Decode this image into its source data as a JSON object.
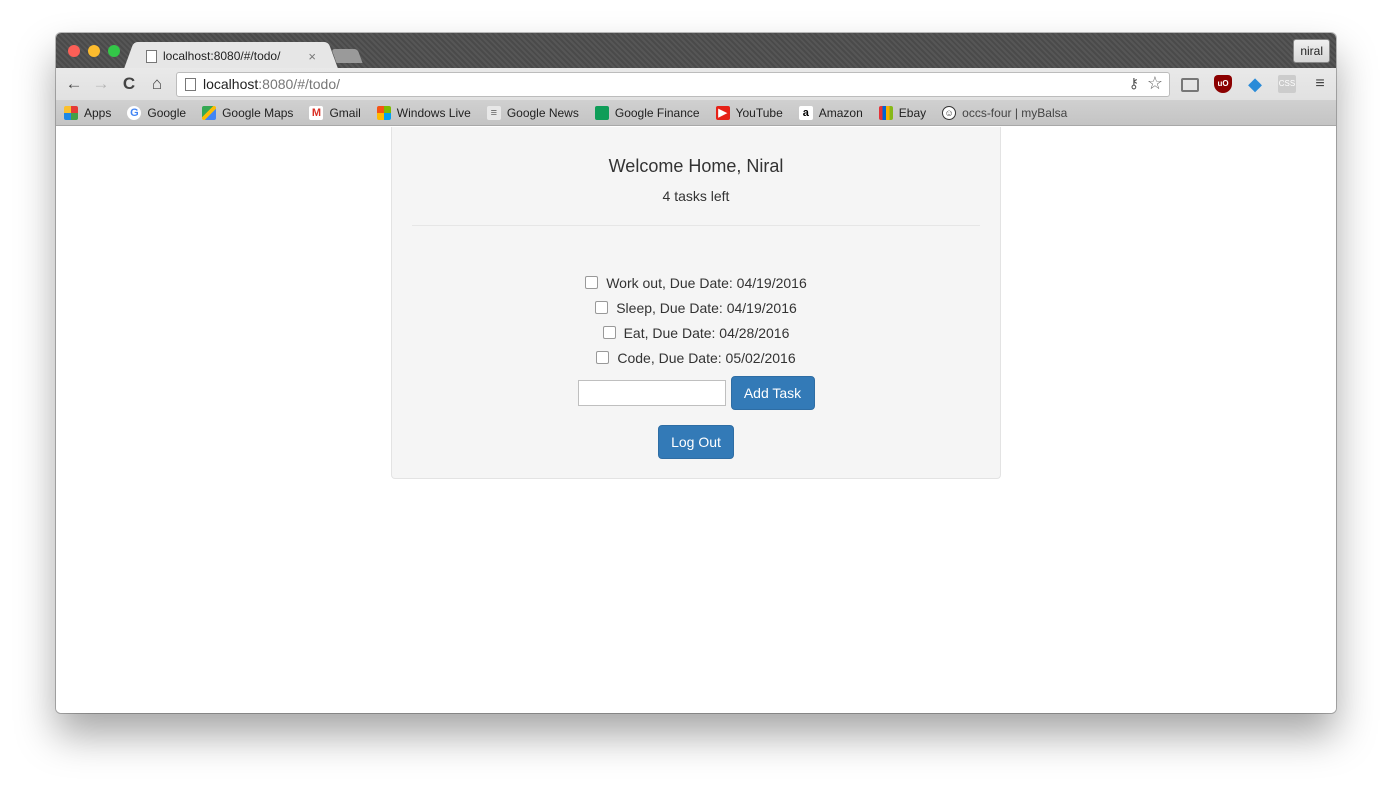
{
  "browser": {
    "tab_title": "localhost:8080/#/todo/",
    "tab_close": "×",
    "profile_name": "niral",
    "url_host": "localhost",
    "url_rest": ":8080/#/todo/",
    "nav": {
      "back": "←",
      "forward": "→",
      "reload": "C",
      "home": "⌂"
    },
    "ext_labels": {
      "ublock": "uO",
      "css": "CSS",
      "menu": "≡"
    }
  },
  "bookmarks": [
    {
      "label": "Apps",
      "icon": "apps-grid-icon"
    },
    {
      "label": "Google",
      "icon": "google-icon"
    },
    {
      "label": "Google Maps",
      "icon": "maps-icon"
    },
    {
      "label": "Gmail",
      "icon": "gmail-icon"
    },
    {
      "label": "Windows Live",
      "icon": "windows-icon"
    },
    {
      "label": "Google News",
      "icon": "news-icon"
    },
    {
      "label": "Google Finance",
      "icon": "finance-icon"
    },
    {
      "label": "YouTube",
      "icon": "youtube-icon"
    },
    {
      "label": "Amazon",
      "icon": "amazon-icon"
    },
    {
      "label": "Ebay",
      "icon": "ebay-icon"
    },
    {
      "label": "occs-four | myBalsa",
      "icon": "smiley-icon"
    }
  ],
  "app": {
    "welcome": "Welcome Home, Niral",
    "remaining": "4 tasks left",
    "tasks": [
      {
        "text": "Work out, Due Date: 04/19/2016",
        "done": false
      },
      {
        "text": "Sleep, Due Date: 04/19/2016",
        "done": false
      },
      {
        "text": "Eat, Due Date: 04/28/2016",
        "done": false
      },
      {
        "text": "Code, Due Date: 05/02/2016",
        "done": false
      }
    ],
    "new_task_value": "",
    "add_label": "Add Task",
    "logout_label": "Log Out"
  },
  "colors": {
    "primary_button": "#337ab7",
    "panel_bg": "#f5f5f5"
  }
}
